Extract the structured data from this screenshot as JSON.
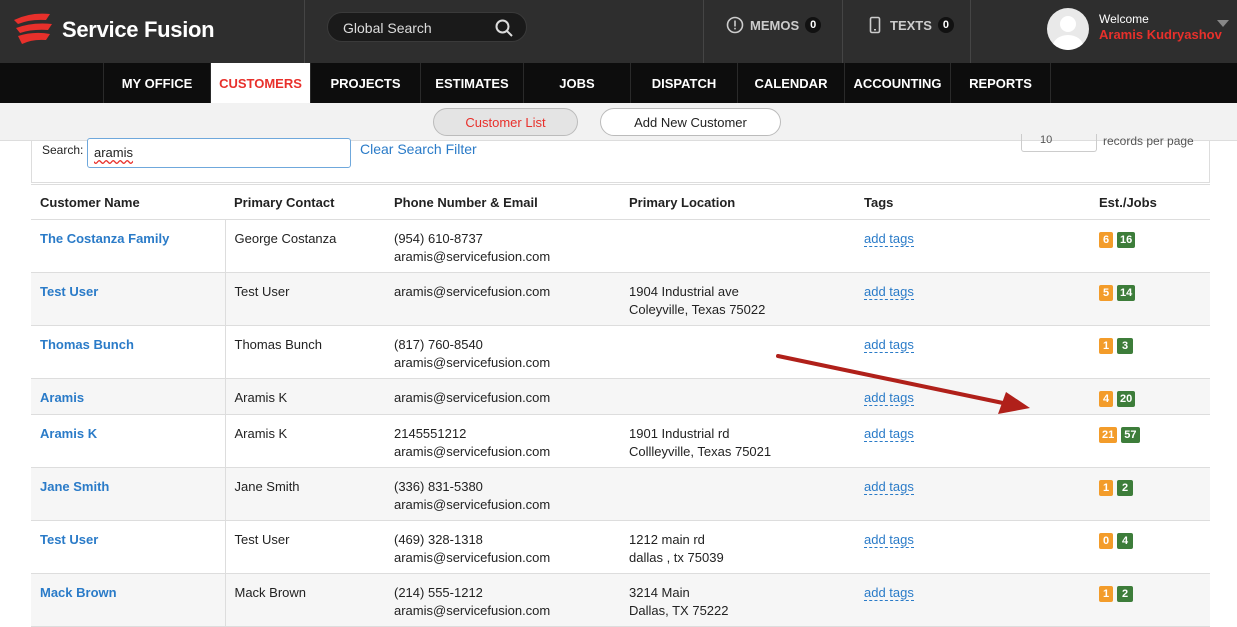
{
  "brand": {
    "name": "Service Fusion",
    "accent": "#e8302b"
  },
  "search": {
    "placeholder": "Global Search"
  },
  "header": {
    "memos_label": "MEMOS",
    "memos_count": "0",
    "texts_label": "TEXTS",
    "texts_count": "0",
    "welcome": "Welcome",
    "user_name": "Aramis Kudryashov"
  },
  "nav": {
    "items": [
      "MY OFFICE",
      "CUSTOMERS",
      "PROJECTS",
      "ESTIMATES",
      "JOBS",
      "DISPATCH",
      "CALENDAR",
      "ACCOUNTING",
      "REPORTS"
    ],
    "active": "CUSTOMERS"
  },
  "subnav": {
    "customer_list": "Customer List",
    "add_new": "Add New Customer"
  },
  "filter": {
    "search_label": "Search:",
    "search_value": "aramis",
    "clear_label": "Clear Search Filter",
    "per_page_value": "10",
    "per_page_label": "records per page"
  },
  "table": {
    "headers": [
      "Customer Name",
      "Primary Contact",
      "Phone Number & Email",
      "Primary Location",
      "Tags",
      "Est./Jobs"
    ],
    "rows": [
      {
        "name": "The Costanza Family",
        "contact": "George Costanza",
        "phone": "(954) 610-8737",
        "email": "aramis@servicefusion.com",
        "loc1": "",
        "loc2": "",
        "tags": "add tags",
        "est": "6",
        "jobs": "16"
      },
      {
        "name": "Test User",
        "contact": "Test User",
        "phone": "aramis@servicefusion.com",
        "email": "",
        "loc1": "1904 Industrial ave",
        "loc2": "Coleyville, Texas 75022",
        "tags": "add tags",
        "est": "5",
        "jobs": "14"
      },
      {
        "name": "Thomas Bunch",
        "contact": "Thomas Bunch",
        "phone": "(817) 760-8540",
        "email": "aramis@servicefusion.com",
        "loc1": "",
        "loc2": "",
        "tags": "add tags",
        "est": "1",
        "jobs": "3"
      },
      {
        "name": "Aramis",
        "contact": "Aramis K",
        "phone": "aramis@servicefusion.com",
        "email": "",
        "loc1": "",
        "loc2": "",
        "tags": "add tags",
        "est": "4",
        "jobs": "20"
      },
      {
        "name": "Aramis K",
        "contact": "Aramis K",
        "phone": "2145551212",
        "email": "aramis@servicefusion.com",
        "loc1": "1901 Industrial rd",
        "loc2": "Collleyville, Texas 75021",
        "tags": "add tags",
        "est": "21",
        "jobs": "57"
      },
      {
        "name": "Jane Smith",
        "contact": "Jane Smith",
        "phone": "(336) 831-5380",
        "email": "aramis@servicefusion.com",
        "loc1": "",
        "loc2": "",
        "tags": "add tags",
        "est": "1",
        "jobs": "2"
      },
      {
        "name": "Test User",
        "contact": "Test User",
        "phone": "(469) 328-1318",
        "email": "aramis@servicefusion.com",
        "loc1": "1212 main rd",
        "loc2": "dallas , tx 75039",
        "tags": "add tags",
        "est": "0",
        "jobs": "4"
      },
      {
        "name": "Mack Brown",
        "contact": "Mack Brown",
        "phone": "(214) 555-1212",
        "email": "aramis@servicefusion.com",
        "loc1": "3214 Main",
        "loc2": "Dallas, TX 75222",
        "tags": "add tags",
        "est": "1",
        "jobs": "2"
      }
    ]
  },
  "colors": {
    "est_badge": "#f39c2a",
    "jobs_badge": "#3d7d3a",
    "link": "#2a7bc8",
    "annotation_arrow": "#b0201a"
  }
}
